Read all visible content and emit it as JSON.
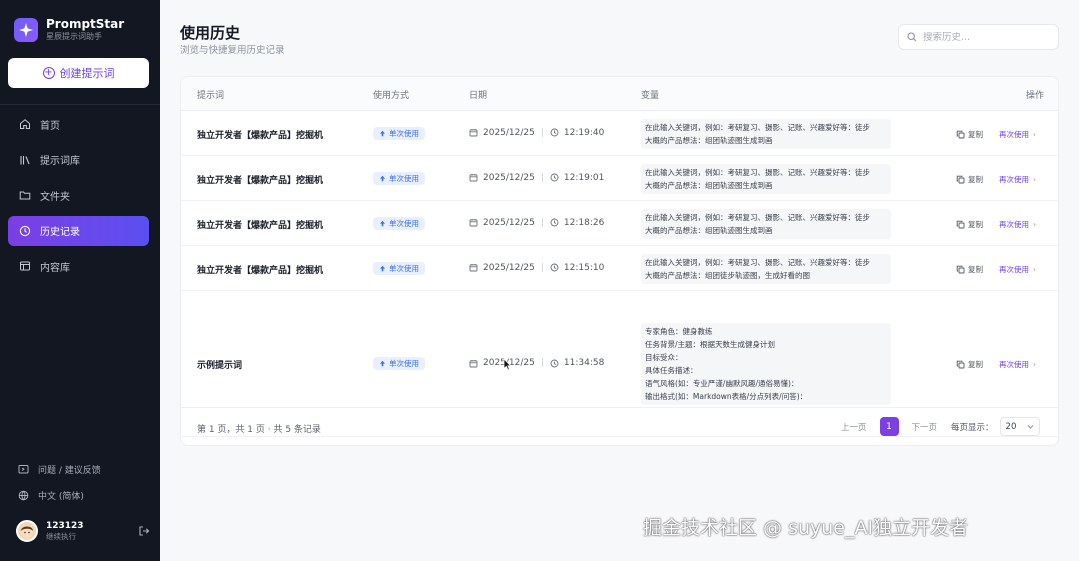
{
  "app": {
    "name": "PromptStar",
    "subtitle": "星辰提示词助手"
  },
  "sidebar": {
    "create_label": "创建提示词",
    "items": [
      {
        "label": "首页",
        "icon": "home-icon"
      },
      {
        "label": "提示词库",
        "icon": "library-icon"
      },
      {
        "label": "文件夹",
        "icon": "folder-icon"
      },
      {
        "label": "历史记录",
        "icon": "history-icon",
        "active": true
      },
      {
        "label": "内容库",
        "icon": "content-library-icon"
      }
    ],
    "feedback_label": "问题 / 建议反馈",
    "language_label": "中文 (简体)",
    "user": {
      "name": "123123",
      "role": "继续执行"
    }
  },
  "header": {
    "title": "使用历史",
    "subtitle": "浏览与快捷复用历史记录",
    "search_placeholder": "搜索历史..."
  },
  "table": {
    "columns": {
      "prompt": "提示词",
      "method": "使用方式",
      "date": "日期",
      "variables": "变量",
      "actions": "操作"
    },
    "rows": [
      {
        "name": "独立开发者【爆款产品】挖掘机",
        "method": "单次使用",
        "date": "2025/12/25",
        "time": "12:19:40",
        "variables": [
          "在此输入关键词，例如：考研复习、摄影、记账、兴趣爱好等：徒步",
          "大概的产品想法：组团轨迹图生成到画"
        ]
      },
      {
        "name": "独立开发者【爆款产品】挖掘机",
        "method": "单次使用",
        "date": "2025/12/25",
        "time": "12:19:01",
        "variables": [
          "在此输入关键词，例如：考研复习、摄影、记账、兴趣爱好等：徒步",
          "大概的产品想法：组团轨迹图生成到画"
        ]
      },
      {
        "name": "独立开发者【爆款产品】挖掘机",
        "method": "单次使用",
        "date": "2025/12/25",
        "time": "12:18:26",
        "variables": [
          "在此输入关键词，例如：考研复习、摄影、记账、兴趣爱好等：徒步",
          "大概的产品想法：组团轨迹图生成到画"
        ]
      },
      {
        "name": "独立开发者【爆款产品】挖掘机",
        "method": "单次使用",
        "date": "2025/12/25",
        "time": "12:15:10",
        "variables": [
          "在此输入关键词，例如：考研复习、摄影、记账、兴趣爱好等：徒步",
          "大概的产品想法：组团徒步轨迹图，生成好看的图"
        ]
      },
      {
        "name": "示例提示词",
        "method": "单次使用",
        "date": "2025/12/25",
        "time": "11:34:58",
        "variables": [
          "专家角色：健身教练",
          "任务背景/主题：根据天数生成健身计划",
          "目标受众：",
          "具体任务描述：",
          "语气风格(如：专业严谨/幽默风趣/通俗易懂)：",
          "输出格式(如：Markdown表格/分点列表/问答)："
        ]
      }
    ],
    "copy_label": "复制",
    "reuse_label": "再次使用"
  },
  "footer": {
    "info": "第 1 页，共 1 页 · 共 5 条记录",
    "prev_label": "上一页",
    "current_page": "1",
    "next_label": "下一页",
    "per_page_label": "每页显示：",
    "per_page_value": "20"
  },
  "watermark": "掘金技术社区 @ suyue_AI独立开发者",
  "colors": {
    "accent": "#7b3fe4",
    "sidebar_bg": "#121722",
    "badge_bg": "#e8efff",
    "badge_text": "#3b6ef0"
  }
}
